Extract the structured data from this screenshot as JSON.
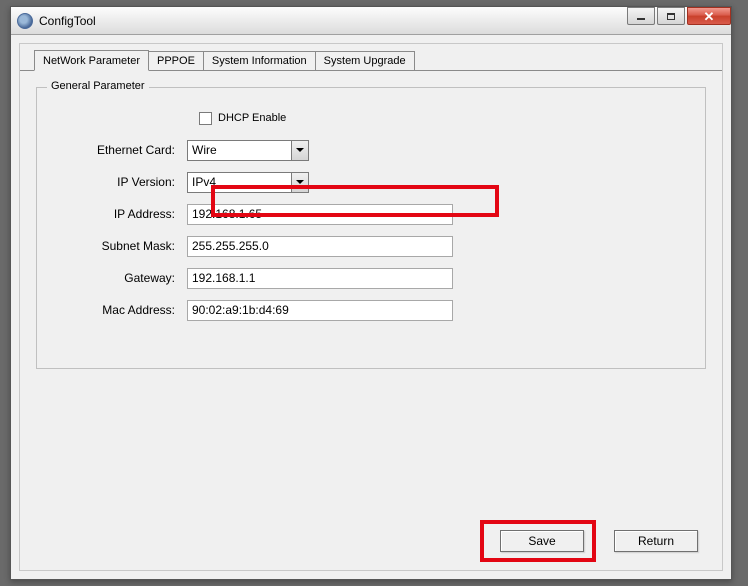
{
  "window": {
    "title": "ConfigTool"
  },
  "tabs": [
    {
      "label": "NetWork Parameter"
    },
    {
      "label": "PPPOE"
    },
    {
      "label": "System Information"
    },
    {
      "label": "System Upgrade"
    }
  ],
  "group": {
    "title": "General Parameter"
  },
  "form": {
    "dhcp_label": "DHCP Enable",
    "ethernet_label": "Ethernet Card:",
    "ethernet_value": "Wire",
    "ipver_label": "IP Version:",
    "ipver_value": "IPv4",
    "ipaddr_label": "IP Address:",
    "ipaddr_value": "192.168.1.65",
    "subnet_label": "Subnet Mask:",
    "subnet_value": "255.255.255.0",
    "gateway_label": "Gateway:",
    "gateway_value": "192.168.1.1",
    "mac_label": "Mac Address:",
    "mac_value": "90:02:a9:1b:d4:69"
  },
  "buttons": {
    "save": "Save",
    "return": "Return"
  }
}
